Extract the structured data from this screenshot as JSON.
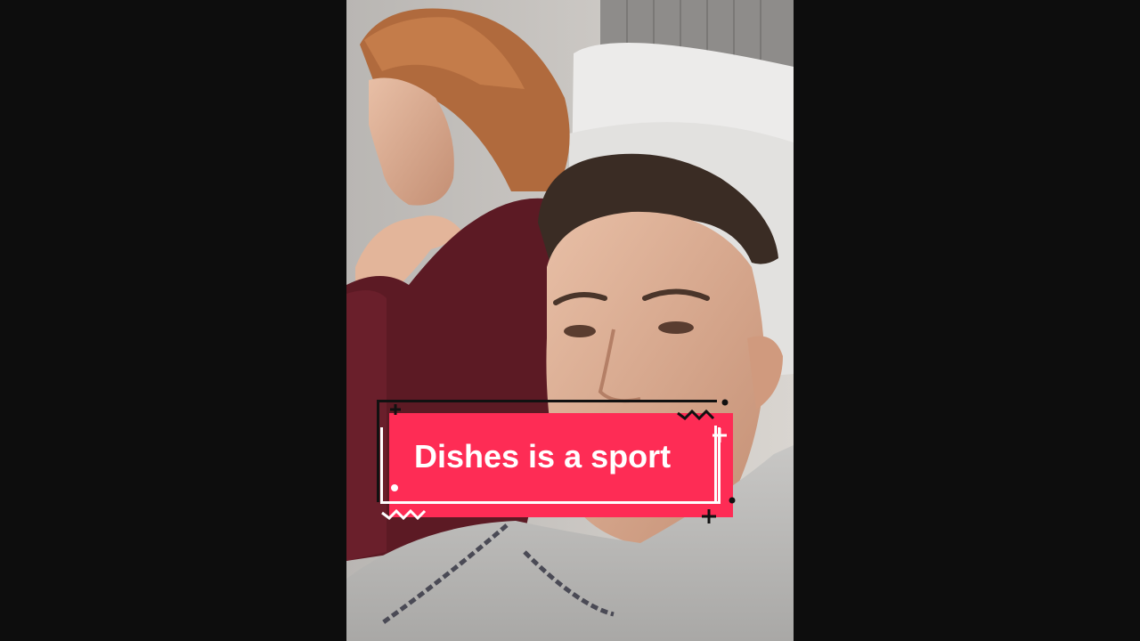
{
  "caption": {
    "text": "Dishes is a sport"
  },
  "colors": {
    "background": "#0d0d0d",
    "sticker_fill": "#fe2c55",
    "sticker_text": "#ffffff"
  },
  "icons": {
    "plus": "+"
  }
}
